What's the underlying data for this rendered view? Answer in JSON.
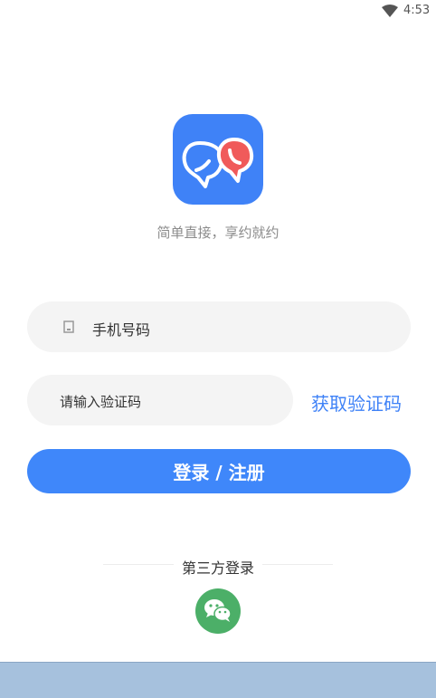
{
  "status_bar": {
    "time": "4:53",
    "wifi_icon": "wifi-icon"
  },
  "logo": {
    "icon": "chat-bubbles-logo",
    "primary_color": "#3f82f7",
    "accent_color": "#f05a5a"
  },
  "slogan": "简单直接，享约就约",
  "phone_field": {
    "placeholder": "手机号码",
    "icon": "phone-icon"
  },
  "code_field": {
    "placeholder": "请输入验证码"
  },
  "get_code_label": "获取验证码",
  "login_button": {
    "label": "登录 / 注册",
    "color": "#3f87fa"
  },
  "third_party": {
    "label": "第三方登录",
    "wechat_icon": "wechat-icon",
    "wechat_color": "#4caf68"
  }
}
